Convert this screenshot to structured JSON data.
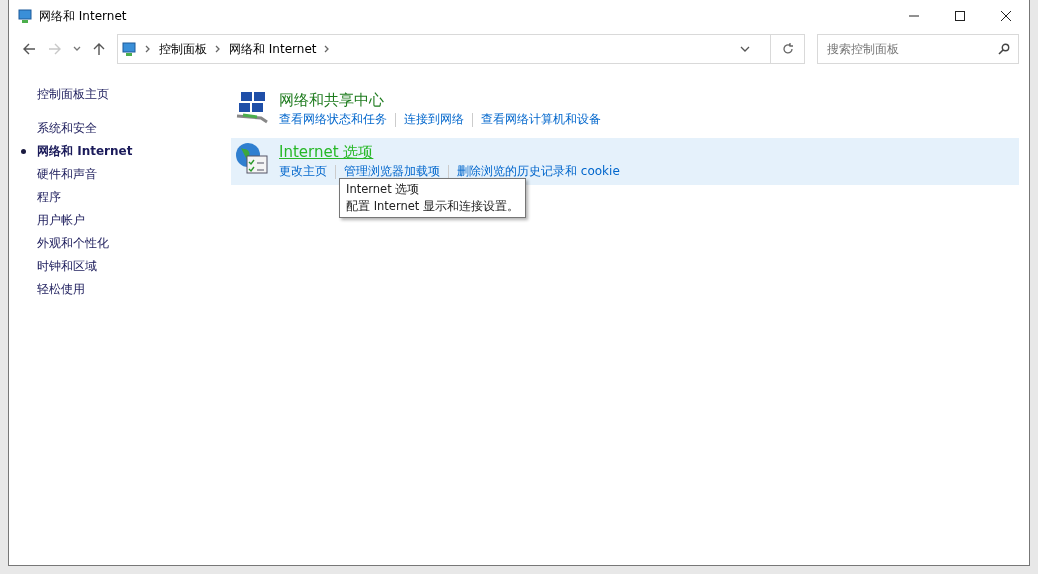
{
  "window": {
    "title": "网络和 Internet"
  },
  "navigation": {
    "back_disabled": false,
    "forward_disabled": true
  },
  "breadcrumb": [
    "控制面板",
    "网络和 Internet"
  ],
  "search": {
    "placeholder": "搜索控制面板"
  },
  "sidebar": {
    "home": "控制面板主页",
    "items": [
      {
        "label": "系统和安全",
        "selected": false
      },
      {
        "label": "网络和 Internet",
        "selected": true
      },
      {
        "label": "硬件和声音",
        "selected": false
      },
      {
        "label": "程序",
        "selected": false
      },
      {
        "label": "用户帐户",
        "selected": false
      },
      {
        "label": "外观和个性化",
        "selected": false
      },
      {
        "label": "时钟和区域",
        "selected": false
      },
      {
        "label": "轻松使用",
        "selected": false
      }
    ]
  },
  "categories": [
    {
      "kind": "network",
      "title": "网络和共享中心",
      "hovered": false,
      "links": [
        "查看网络状态和任务",
        "连接到网络",
        "查看网络计算机和设备"
      ]
    },
    {
      "kind": "globe",
      "title": "Internet 选项",
      "hovered": true,
      "links": [
        "更改主页",
        "管理浏览器加载项",
        "删除浏览的历史记录和 cookie"
      ]
    }
  ],
  "tooltip": {
    "title": "Internet 选项",
    "text": "配置 Internet 显示和连接设置。"
  }
}
